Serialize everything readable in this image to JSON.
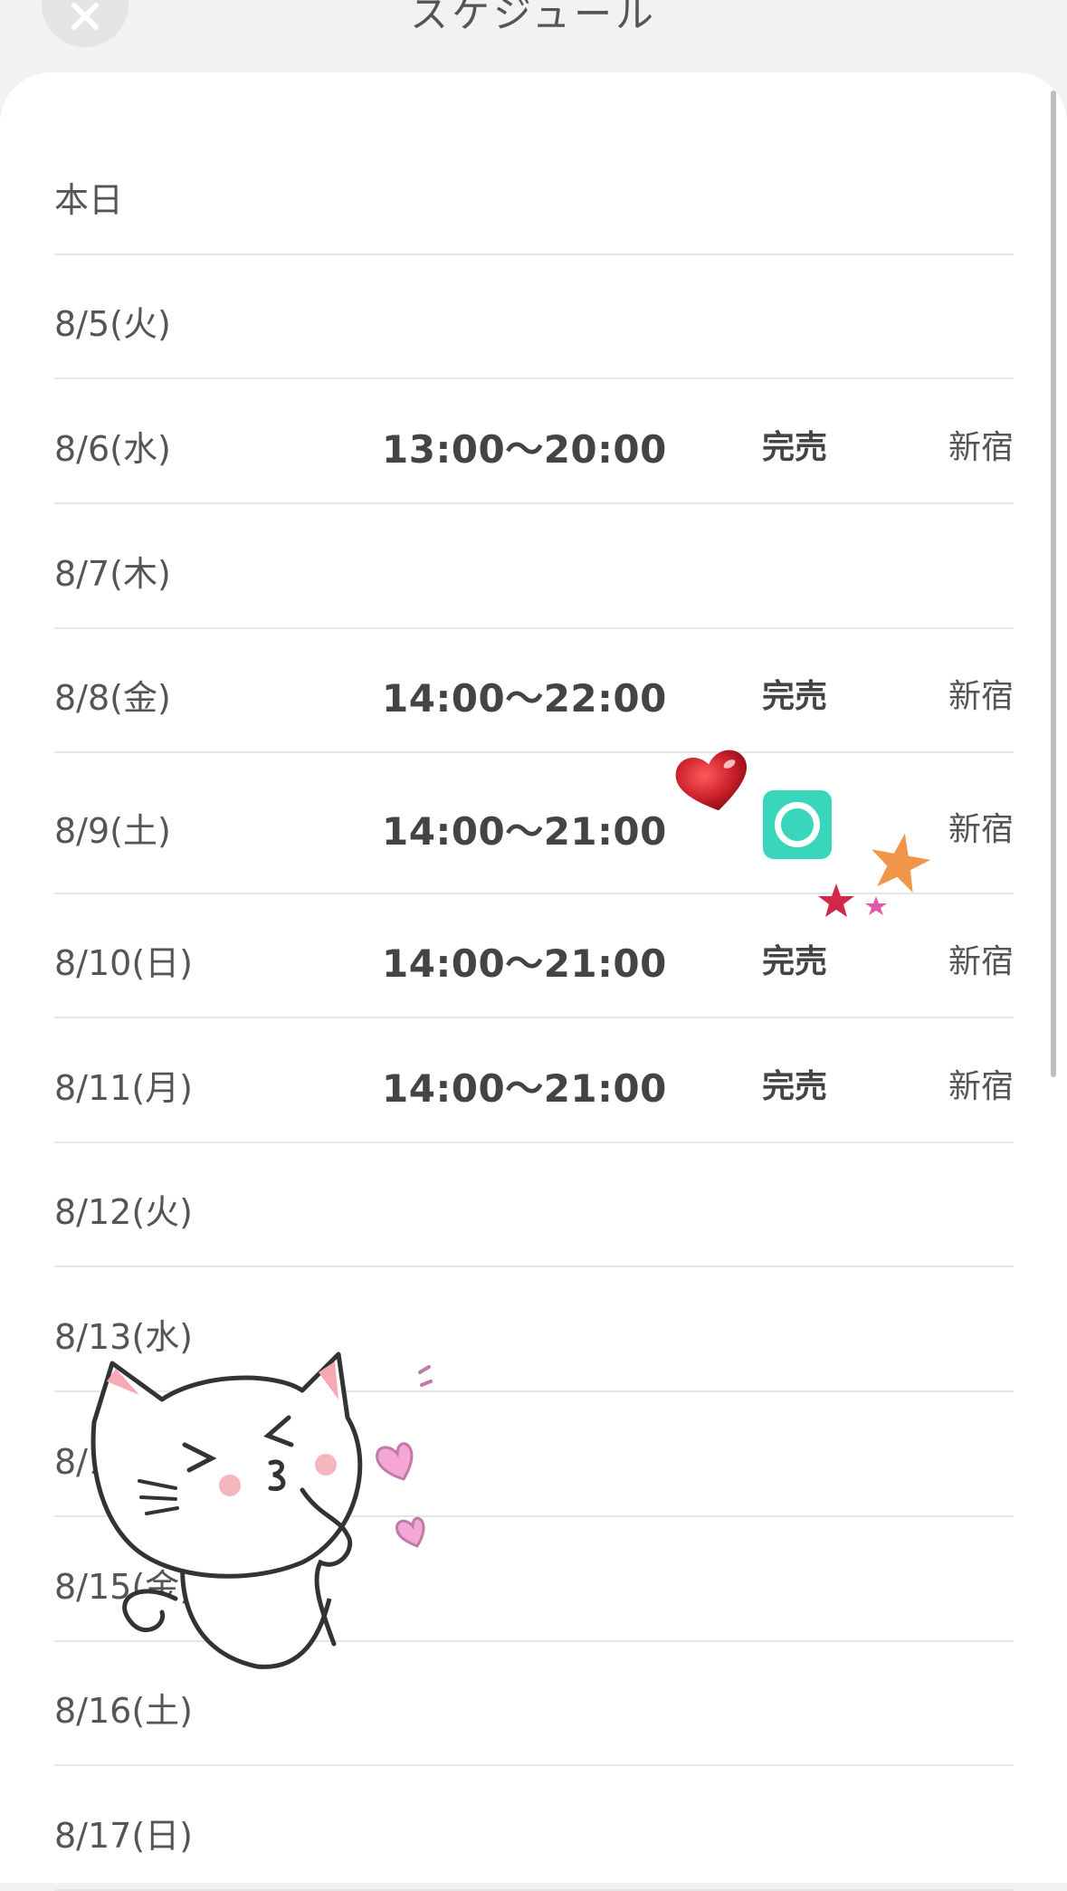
{
  "header": {
    "title": "スケジュール",
    "close_icon": "close-icon"
  },
  "schedule": [
    {
      "date": "本日",
      "time": "",
      "status": "",
      "place": ""
    },
    {
      "date": "8/5(火)",
      "time": "",
      "status": "",
      "place": ""
    },
    {
      "date": "8/6(水)",
      "time": "13:00〜20:00",
      "status": "完売",
      "place": "新宿"
    },
    {
      "date": "8/7(木)",
      "time": "",
      "status": "",
      "place": ""
    },
    {
      "date": "8/8(金)",
      "time": "14:00〜22:00",
      "status": "完売",
      "place": "新宿"
    },
    {
      "date": "8/9(土)",
      "time": "14:00〜21:00",
      "status": "",
      "status_icon": "available-circle-icon",
      "place": "新宿"
    },
    {
      "date": "8/10(日)",
      "time": "14:00〜21:00",
      "status": "完売",
      "place": "新宿"
    },
    {
      "date": "8/11(月)",
      "time": "14:00〜21:00",
      "status": "完売",
      "place": "新宿"
    },
    {
      "date": "8/12(火)",
      "time": "",
      "status": "",
      "place": ""
    },
    {
      "date": "8/13(水)",
      "time": "",
      "status": "",
      "place": ""
    },
    {
      "date": "8/14(木)",
      "time": "",
      "status": "",
      "place": ""
    },
    {
      "date": "8/15(金)",
      "time": "",
      "status": "",
      "place": ""
    },
    {
      "date": "8/16(土)",
      "time": "",
      "status": "",
      "place": ""
    },
    {
      "date": "8/17(日)",
      "time": "",
      "status": "",
      "place": ""
    }
  ],
  "colors": {
    "available_badge": "#3ad6bc",
    "heart": "#c81e28",
    "star_orange": "#f0964a",
    "star_red": "#d02848",
    "star_pink": "#e05aa8"
  },
  "stickers": [
    "heart-sticker",
    "stars-sticker",
    "cat-sticker"
  ]
}
